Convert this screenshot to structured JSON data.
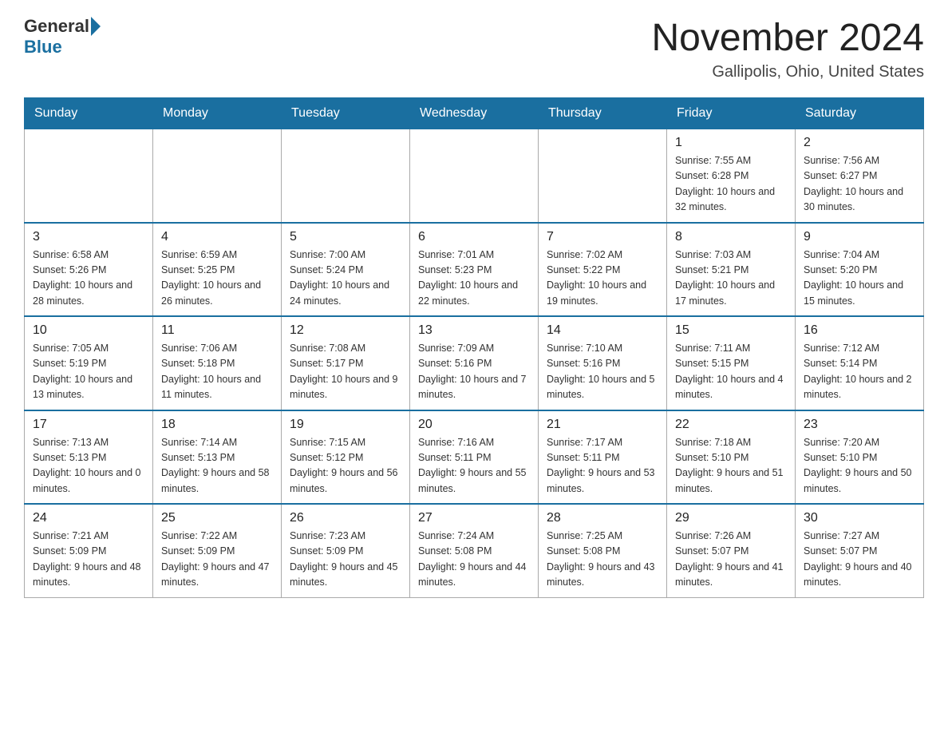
{
  "header": {
    "logo_general": "General",
    "logo_blue": "Blue",
    "month_title": "November 2024",
    "location": "Gallipolis, Ohio, United States"
  },
  "days_of_week": [
    "Sunday",
    "Monday",
    "Tuesday",
    "Wednesday",
    "Thursday",
    "Friday",
    "Saturday"
  ],
  "weeks": [
    [
      {
        "day": "",
        "sunrise": "",
        "sunset": "",
        "daylight": ""
      },
      {
        "day": "",
        "sunrise": "",
        "sunset": "",
        "daylight": ""
      },
      {
        "day": "",
        "sunrise": "",
        "sunset": "",
        "daylight": ""
      },
      {
        "day": "",
        "sunrise": "",
        "sunset": "",
        "daylight": ""
      },
      {
        "day": "",
        "sunrise": "",
        "sunset": "",
        "daylight": ""
      },
      {
        "day": "1",
        "sunrise": "Sunrise: 7:55 AM",
        "sunset": "Sunset: 6:28 PM",
        "daylight": "Daylight: 10 hours and 32 minutes."
      },
      {
        "day": "2",
        "sunrise": "Sunrise: 7:56 AM",
        "sunset": "Sunset: 6:27 PM",
        "daylight": "Daylight: 10 hours and 30 minutes."
      }
    ],
    [
      {
        "day": "3",
        "sunrise": "Sunrise: 6:58 AM",
        "sunset": "Sunset: 5:26 PM",
        "daylight": "Daylight: 10 hours and 28 minutes."
      },
      {
        "day": "4",
        "sunrise": "Sunrise: 6:59 AM",
        "sunset": "Sunset: 5:25 PM",
        "daylight": "Daylight: 10 hours and 26 minutes."
      },
      {
        "day": "5",
        "sunrise": "Sunrise: 7:00 AM",
        "sunset": "Sunset: 5:24 PM",
        "daylight": "Daylight: 10 hours and 24 minutes."
      },
      {
        "day": "6",
        "sunrise": "Sunrise: 7:01 AM",
        "sunset": "Sunset: 5:23 PM",
        "daylight": "Daylight: 10 hours and 22 minutes."
      },
      {
        "day": "7",
        "sunrise": "Sunrise: 7:02 AM",
        "sunset": "Sunset: 5:22 PM",
        "daylight": "Daylight: 10 hours and 19 minutes."
      },
      {
        "day": "8",
        "sunrise": "Sunrise: 7:03 AM",
        "sunset": "Sunset: 5:21 PM",
        "daylight": "Daylight: 10 hours and 17 minutes."
      },
      {
        "day": "9",
        "sunrise": "Sunrise: 7:04 AM",
        "sunset": "Sunset: 5:20 PM",
        "daylight": "Daylight: 10 hours and 15 minutes."
      }
    ],
    [
      {
        "day": "10",
        "sunrise": "Sunrise: 7:05 AM",
        "sunset": "Sunset: 5:19 PM",
        "daylight": "Daylight: 10 hours and 13 minutes."
      },
      {
        "day": "11",
        "sunrise": "Sunrise: 7:06 AM",
        "sunset": "Sunset: 5:18 PM",
        "daylight": "Daylight: 10 hours and 11 minutes."
      },
      {
        "day": "12",
        "sunrise": "Sunrise: 7:08 AM",
        "sunset": "Sunset: 5:17 PM",
        "daylight": "Daylight: 10 hours and 9 minutes."
      },
      {
        "day": "13",
        "sunrise": "Sunrise: 7:09 AM",
        "sunset": "Sunset: 5:16 PM",
        "daylight": "Daylight: 10 hours and 7 minutes."
      },
      {
        "day": "14",
        "sunrise": "Sunrise: 7:10 AM",
        "sunset": "Sunset: 5:16 PM",
        "daylight": "Daylight: 10 hours and 5 minutes."
      },
      {
        "day": "15",
        "sunrise": "Sunrise: 7:11 AM",
        "sunset": "Sunset: 5:15 PM",
        "daylight": "Daylight: 10 hours and 4 minutes."
      },
      {
        "day": "16",
        "sunrise": "Sunrise: 7:12 AM",
        "sunset": "Sunset: 5:14 PM",
        "daylight": "Daylight: 10 hours and 2 minutes."
      }
    ],
    [
      {
        "day": "17",
        "sunrise": "Sunrise: 7:13 AM",
        "sunset": "Sunset: 5:13 PM",
        "daylight": "Daylight: 10 hours and 0 minutes."
      },
      {
        "day": "18",
        "sunrise": "Sunrise: 7:14 AM",
        "sunset": "Sunset: 5:13 PM",
        "daylight": "Daylight: 9 hours and 58 minutes."
      },
      {
        "day": "19",
        "sunrise": "Sunrise: 7:15 AM",
        "sunset": "Sunset: 5:12 PM",
        "daylight": "Daylight: 9 hours and 56 minutes."
      },
      {
        "day": "20",
        "sunrise": "Sunrise: 7:16 AM",
        "sunset": "Sunset: 5:11 PM",
        "daylight": "Daylight: 9 hours and 55 minutes."
      },
      {
        "day": "21",
        "sunrise": "Sunrise: 7:17 AM",
        "sunset": "Sunset: 5:11 PM",
        "daylight": "Daylight: 9 hours and 53 minutes."
      },
      {
        "day": "22",
        "sunrise": "Sunrise: 7:18 AM",
        "sunset": "Sunset: 5:10 PM",
        "daylight": "Daylight: 9 hours and 51 minutes."
      },
      {
        "day": "23",
        "sunrise": "Sunrise: 7:20 AM",
        "sunset": "Sunset: 5:10 PM",
        "daylight": "Daylight: 9 hours and 50 minutes."
      }
    ],
    [
      {
        "day": "24",
        "sunrise": "Sunrise: 7:21 AM",
        "sunset": "Sunset: 5:09 PM",
        "daylight": "Daylight: 9 hours and 48 minutes."
      },
      {
        "day": "25",
        "sunrise": "Sunrise: 7:22 AM",
        "sunset": "Sunset: 5:09 PM",
        "daylight": "Daylight: 9 hours and 47 minutes."
      },
      {
        "day": "26",
        "sunrise": "Sunrise: 7:23 AM",
        "sunset": "Sunset: 5:09 PM",
        "daylight": "Daylight: 9 hours and 45 minutes."
      },
      {
        "day": "27",
        "sunrise": "Sunrise: 7:24 AM",
        "sunset": "Sunset: 5:08 PM",
        "daylight": "Daylight: 9 hours and 44 minutes."
      },
      {
        "day": "28",
        "sunrise": "Sunrise: 7:25 AM",
        "sunset": "Sunset: 5:08 PM",
        "daylight": "Daylight: 9 hours and 43 minutes."
      },
      {
        "day": "29",
        "sunrise": "Sunrise: 7:26 AM",
        "sunset": "Sunset: 5:07 PM",
        "daylight": "Daylight: 9 hours and 41 minutes."
      },
      {
        "day": "30",
        "sunrise": "Sunrise: 7:27 AM",
        "sunset": "Sunset: 5:07 PM",
        "daylight": "Daylight: 9 hours and 40 minutes."
      }
    ]
  ]
}
